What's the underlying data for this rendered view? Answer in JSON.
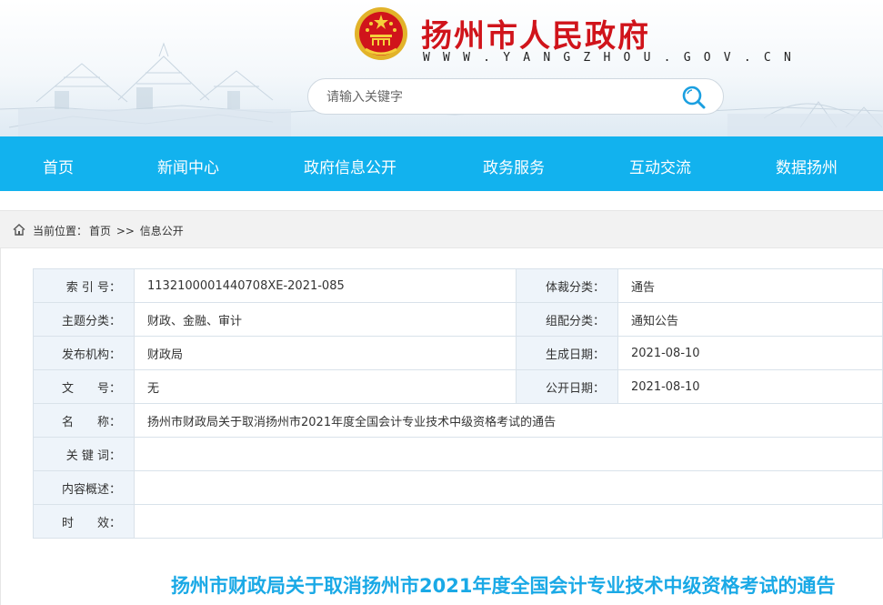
{
  "header": {
    "site_title": "扬州市人民政府",
    "site_url": "W W W . Y A N G Z H O U . G O V . C N",
    "search": {
      "placeholder": "请输入关键字"
    }
  },
  "nav": {
    "items": [
      {
        "label": "首页"
      },
      {
        "label": "新闻中心"
      },
      {
        "label": "政府信息公开"
      },
      {
        "label": "政务服务"
      },
      {
        "label": "互动交流"
      },
      {
        "label": "数据扬州"
      }
    ],
    "background": "#12b2ee"
  },
  "breadcrumb": {
    "prefix": "当前位置：",
    "home": "首页",
    "separator": " >> ",
    "current": "信息公开"
  },
  "meta": {
    "index_label": "索 引 号：",
    "index_value": "1132100001440708XE-2021-085",
    "genre_label": "体裁分类：",
    "genre_value": "通告",
    "topic_label": "主题分类：",
    "topic_value": "财政、金融、审计",
    "group_label": "组配分类：",
    "group_value": "通知公告",
    "org_label": "发布机构：",
    "org_value": "财政局",
    "created_label": "生成日期：",
    "created_value": "2021-08-10",
    "docno_label": "文　　号：",
    "docno_value": "无",
    "published_label": "公开日期：",
    "published_value": "2021-08-10",
    "name_label": "名　　称：",
    "name_value": "扬州市财政局关于取消扬州市2021年度全国会计专业技术中级资格考试的通告",
    "keywords_label": "关 键 词：",
    "keywords_value": "",
    "summary_label": "内容概述：",
    "summary_value": "",
    "validity_label": "时　　效：",
    "validity_value": ""
  },
  "article": {
    "title": "扬州市财政局关于取消扬州市2021年度全国会计专业技术中级资格考试的通告"
  },
  "colors": {
    "title_red": "#d0141b",
    "nav_blue": "#12b2ee",
    "article_title_blue": "#1aa9e6",
    "label_bg": "#eef4fa"
  }
}
